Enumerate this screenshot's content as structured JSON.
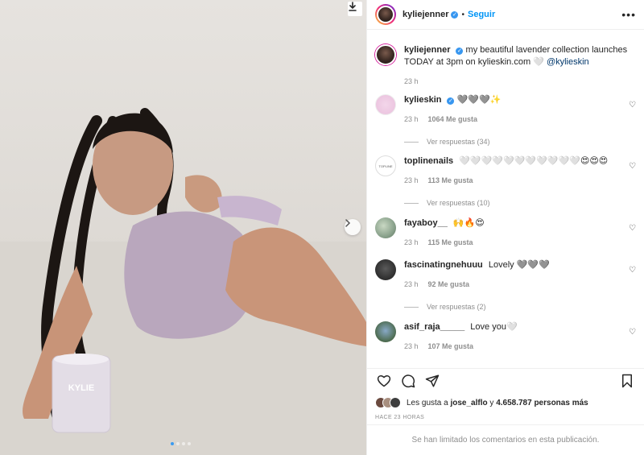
{
  "post": {
    "username": "kyliejenner",
    "separator": "•",
    "follow_label": "Seguir",
    "more_label": "•••",
    "caption": {
      "username": "kyliejenner",
      "text": "my beautiful lavender collection launches TODAY at 3pm on kylieskin.com 🤍 ",
      "mention": "@kylieskin",
      "time": "23 h"
    }
  },
  "media": {
    "candle_text": "KYLIE",
    "carousel_dots": 4,
    "active_dot": 1
  },
  "comments": [
    {
      "username": "kylieskin",
      "verified": true,
      "text": "🩶🩶🩶✨",
      "time": "23 h",
      "likes": "1064 Me gusta",
      "replies": "Ver respuestas (34)"
    },
    {
      "username": "toplinenails",
      "verified": false,
      "text": "🤍🤍🤍🤍🤍🤍🤍🤍🤍🤍🤍😍😍😍",
      "time": "23 h",
      "likes": "113 Me gusta",
      "replies": "Ver respuestas (10)"
    },
    {
      "username": "fayaboy__",
      "verified": false,
      "text": "🙌🔥😍",
      "time": "23 h",
      "likes": "115 Me gusta",
      "replies": ""
    },
    {
      "username": "fascinatingnehuuu",
      "verified": false,
      "text": "Lovely 🩶🩶🩶",
      "time": "23 h",
      "likes": "92 Me gusta",
      "replies": "Ver respuestas (2)"
    },
    {
      "username": "asif_raja_____",
      "verified": false,
      "text": "Love you🤍",
      "time": "23 h",
      "likes": "107 Me gusta",
      "replies": ""
    }
  ],
  "likes_summary": {
    "prefix": "Les gusta a ",
    "user": "jose_alflo",
    "middle": " y ",
    "count": "4.658.787 personas más"
  },
  "ago": "HACE 23 HORAS",
  "comments_limited": "Se han limitado los comentarios en esta publicación.",
  "colors": {
    "accent": "#0095f6",
    "verified": "#3897f0",
    "muted": "#8e8e8e",
    "text": "#262626"
  },
  "icons": {
    "download": "download-icon",
    "next": "chevron-right-icon",
    "like": "heart-icon",
    "comment": "comment-icon",
    "share": "paper-plane-icon",
    "save": "bookmark-icon"
  }
}
